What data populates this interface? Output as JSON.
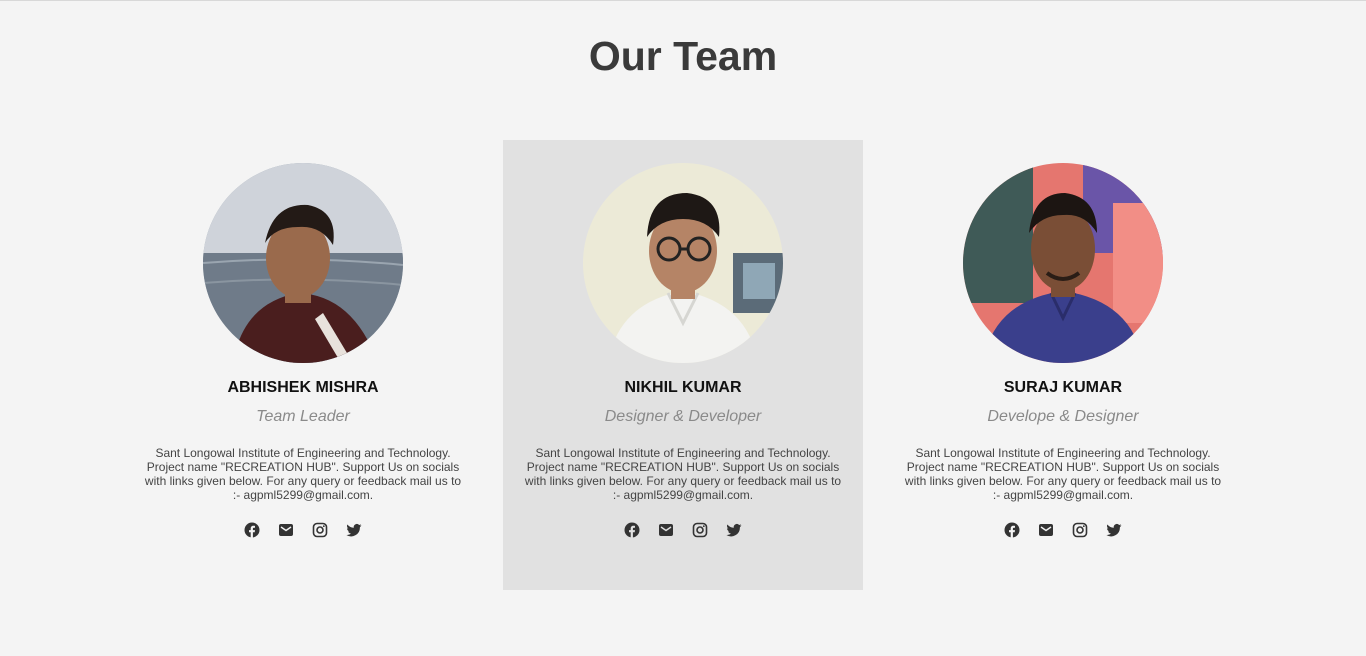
{
  "page": {
    "title": "Our Team"
  },
  "members": [
    {
      "name": "ABHISHEK MISHRA",
      "role": "Team Leader",
      "bio": "Sant Longowal Institute of Engineering and Technology. Project name \"RECREATION HUB\". Support Us on socials with links given below. For any query or feedback mail us to :- agpml5299@gmail.com."
    },
    {
      "name": "NIKHIL KUMAR",
      "role": "Designer & Developer",
      "bio": "Sant Longowal Institute of Engineering and Technology. Project name \"RECREATION HUB\". Support Us on socials with links given below. For any query or feedback mail us to :- agpml5299@gmail.com."
    },
    {
      "name": "SURAJ KUMAR",
      "role": "Develope & Designer",
      "bio": "Sant Longowal Institute of Engineering and Technology. Project name \"RECREATION HUB\". Support Us on socials with links given below. For any query or feedback mail us to :- agpml5299@gmail.com."
    }
  ],
  "social_icons": [
    "facebook-icon",
    "envelope-icon",
    "instagram-icon",
    "twitter-icon"
  ],
  "colors": {
    "background": "#f4f4f4",
    "highlight_card": "#e1e1e1",
    "title": "#3a3a3a",
    "role": "#8a8a8a",
    "icon": "#333333"
  }
}
